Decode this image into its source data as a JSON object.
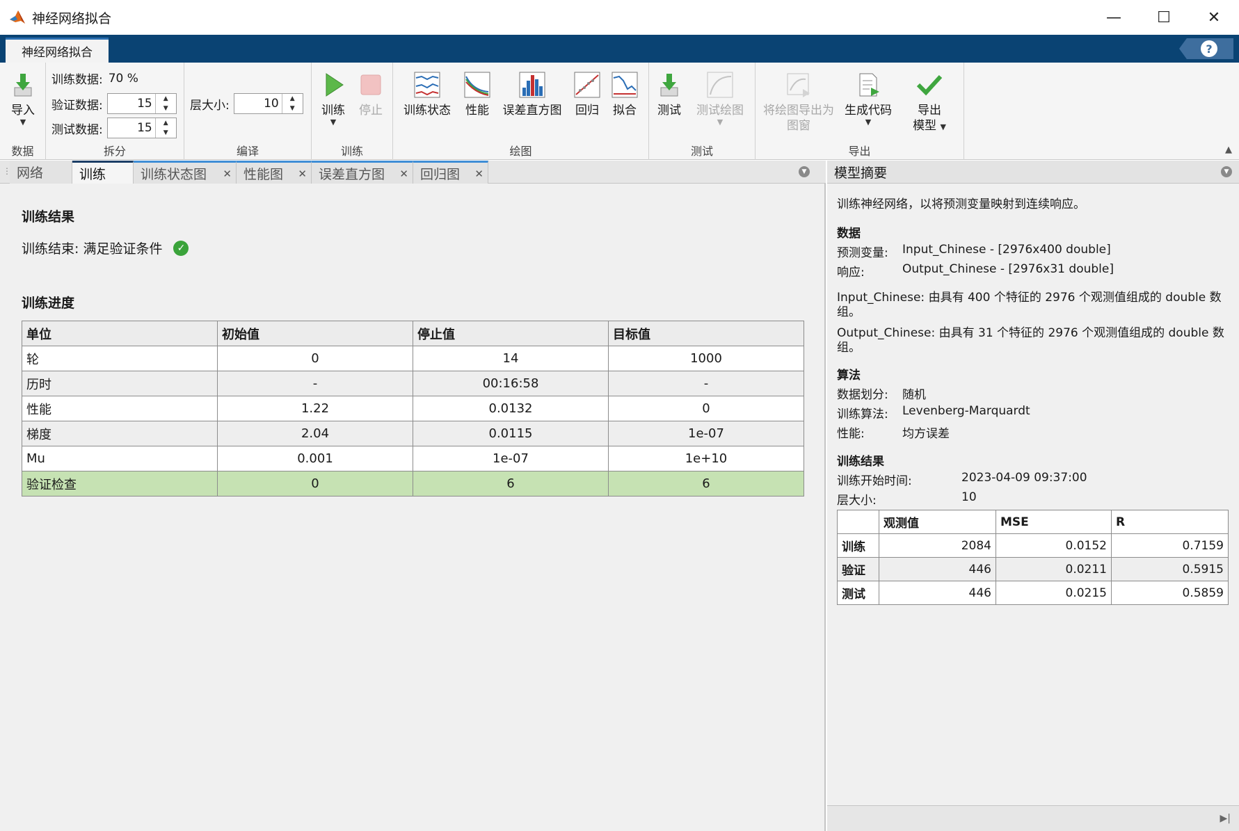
{
  "window": {
    "title": "神经网络拟合",
    "minimize": "—",
    "maximize": "☐",
    "close": "✕"
  },
  "app_tab": {
    "label": "神经网络拟合"
  },
  "help": {
    "label": "?"
  },
  "ribbon": {
    "data_group": {
      "label": "数据",
      "import": "导入"
    },
    "split_group": {
      "label": "拆分",
      "train_label": "训练数据:",
      "train_value": "70 %",
      "val_label": "验证数据:",
      "val_value": "15",
      "test_label": "测试数据:",
      "test_value": "15"
    },
    "compile_group": {
      "label": "编译",
      "layer_label": "层大小:",
      "layer_value": "10"
    },
    "train_group": {
      "label": "训练",
      "train": "训练",
      "stop": "停止"
    },
    "plot_group": {
      "label": "绘图",
      "train_state": "训练状态",
      "performance": "性能",
      "error_hist": "误差直方图",
      "regression": "回归",
      "fit": "拟合"
    },
    "test_group": {
      "label": "测试",
      "test": "测试",
      "test_plot": "测试绘图"
    },
    "export_group": {
      "label": "导出",
      "export_plot_line1": "将绘图导出为",
      "export_plot_line2": "图窗",
      "gen_code": "生成代码",
      "export_model_line1": "导出",
      "export_model_line2": "模型"
    }
  },
  "doc_tabs": [
    "网络",
    "训练",
    "训练状态图",
    "性能图",
    "误差直方图",
    "回归图"
  ],
  "training": {
    "results_title": "训练结果",
    "status": "训练结束: 满足验证条件",
    "progress_title": "训练进度",
    "columns": [
      "单位",
      "初始值",
      "停止值",
      "目标值"
    ],
    "rows": [
      [
        "轮",
        "0",
        "14",
        "1000"
      ],
      [
        "历时",
        "-",
        "00:16:58",
        "-"
      ],
      [
        "性能",
        "1.22",
        "0.0132",
        "0"
      ],
      [
        "梯度",
        "2.04",
        "0.0115",
        "1e-07"
      ],
      [
        "Mu",
        "0.001",
        "1e-07",
        "1e+10"
      ],
      [
        "验证检查",
        "0",
        "6",
        "6"
      ]
    ]
  },
  "summary": {
    "title": "模型摘要",
    "intro": "训练神经网络，以将预测变量映射到连续响应。",
    "data_title": "数据",
    "predictor_key": "预测变量:",
    "predictor_val": "Input_Chinese - [2976x400 double]",
    "response_key": "响应:",
    "response_val": "Output_Chinese - [2976x31 double]",
    "input_desc_line1": "Input_Chinese: 由具有 400 个特征的 2976 个观测值组成的 double 数",
    "input_desc_line2": "组。",
    "output_desc_line1": "Output_Chinese: 由具有 31 个特征的 2976 个观测值组成的 double 数",
    "output_desc_line2": "组。",
    "algo_title": "算法",
    "split_key": "数据划分:",
    "split_val": "随机",
    "algo_key": "训练算法:",
    "algo_val": "Levenberg-Marquardt",
    "perf_key": "性能:",
    "perf_val": "均方误差",
    "results_title": "训练结果",
    "start_key": "训练开始时间:",
    "start_val": "2023-04-09 09:37:00",
    "layer_key": "层大小:",
    "layer_val": "10",
    "table_columns": [
      "",
      "观测值",
      "MSE",
      "R"
    ],
    "table_rows": [
      [
        "训练",
        "2084",
        "0.0152",
        "0.7159"
      ],
      [
        "验证",
        "446",
        "0.0211",
        "0.5915"
      ],
      [
        "测试",
        "446",
        "0.0215",
        "0.5859"
      ]
    ]
  }
}
